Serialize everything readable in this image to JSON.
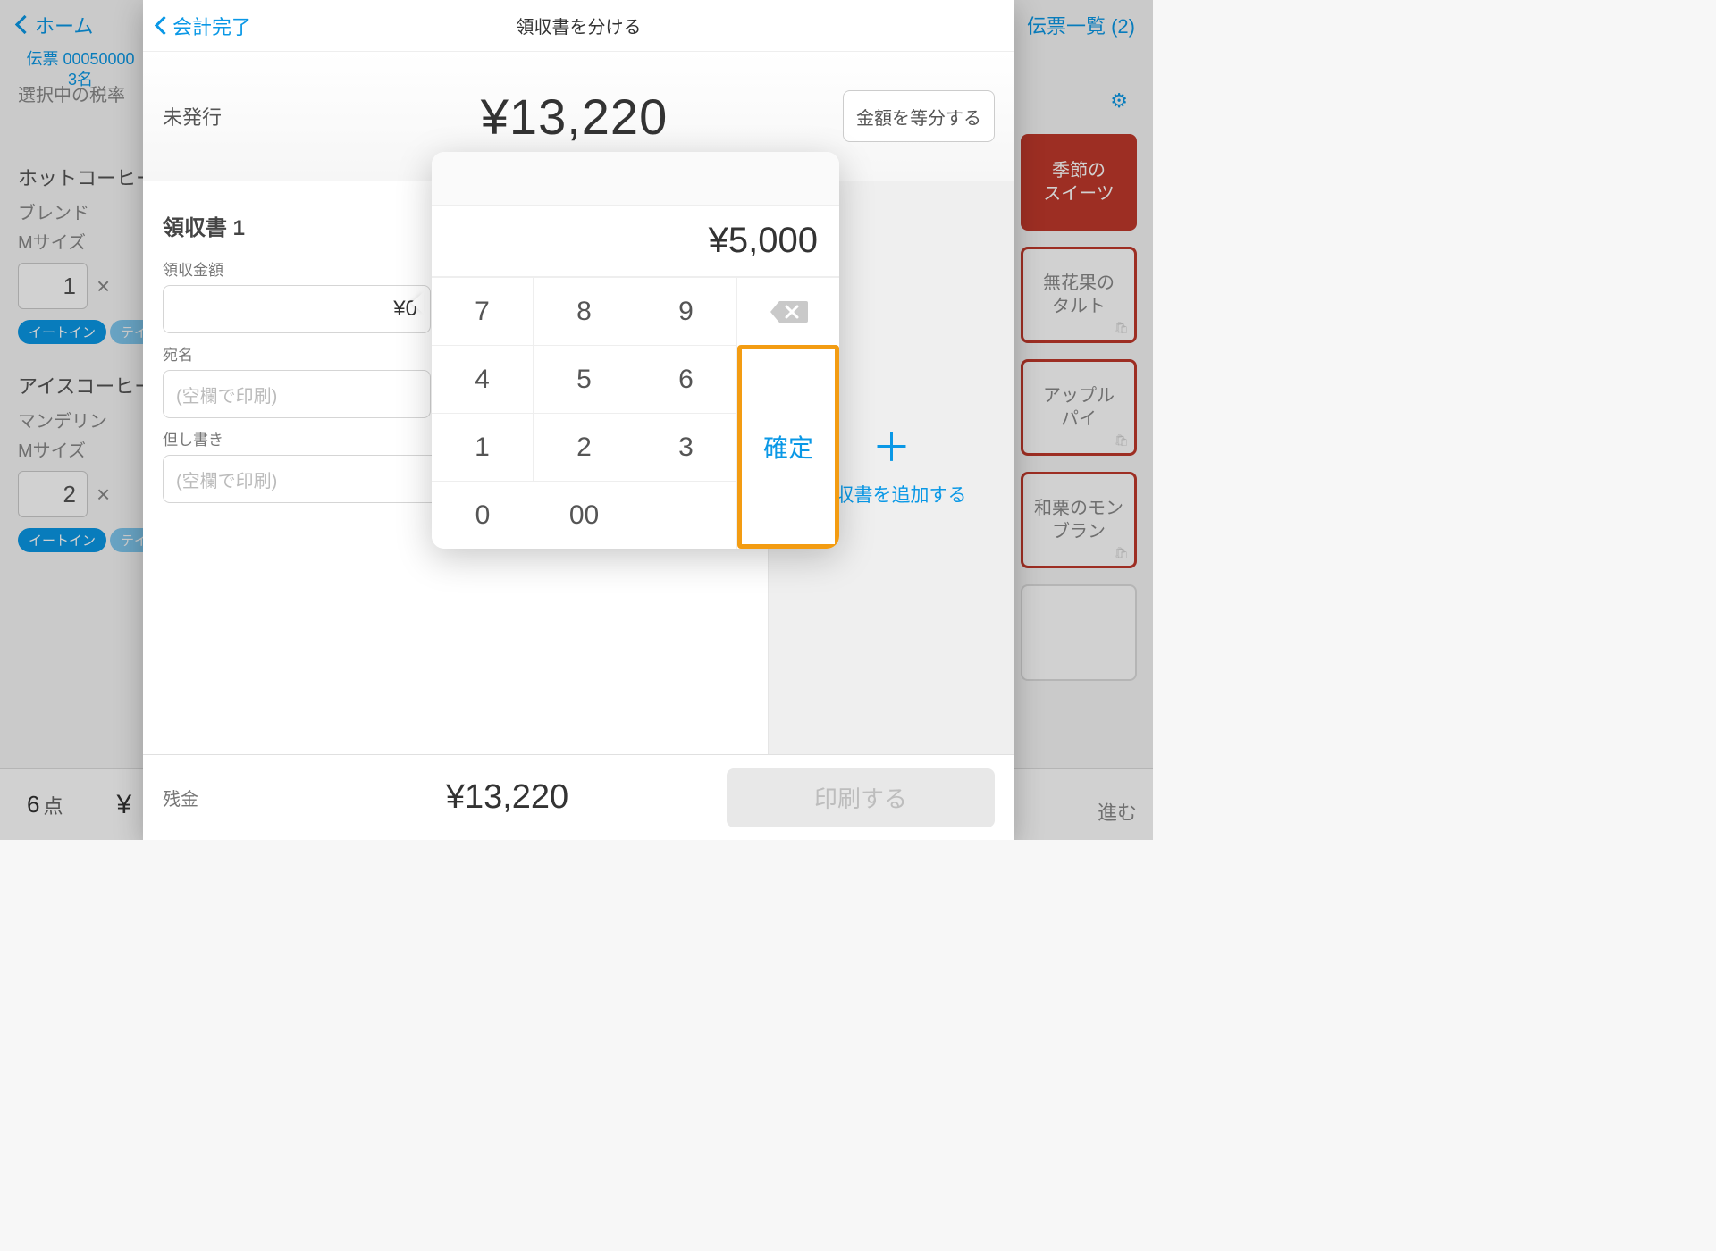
{
  "bg": {
    "home": "ホーム",
    "slipList": "伝票一覧 (2)",
    "slipNo": "伝票 00050000",
    "guests": "3名",
    "taxLabel": "選択中の税率",
    "cat1": "ホットコーヒー",
    "item1_name": "ブレンド",
    "item1_size": "Mサイズ",
    "item1_qty": "1",
    "cat2": "アイスコーヒー",
    "item2_name": "マンデリン",
    "item2_size": "Mサイズ",
    "item2_qty": "2",
    "eatin": "イートイン",
    "takeout": "テイ",
    "points": "6",
    "pointsUnit": "点",
    "yen": "¥",
    "proceed": "進む",
    "card1": "季節の\nスイーツ",
    "card2": "無花果の\nタルト",
    "card3": "アップル\nパイ",
    "card4": "和栗のモン\nブラン"
  },
  "modal": {
    "back": "会計完了",
    "title": "領収書を分ける",
    "unissued": "未発行",
    "total": "¥13,220",
    "equalSplit": "金額を等分する",
    "receiptTitle": "領収書 1",
    "amountLabel": "領収金額",
    "amountValue": "¥0",
    "nameLabel": "宛名",
    "namePlaceholder": "(空欄で印刷)",
    "noteLabel": "但し書き",
    "notePlaceholder": "(空欄で印刷)",
    "addReceipt": "領収書を追加する",
    "remainLabel": "残金",
    "remainValue": "¥13,220",
    "print": "印刷する"
  },
  "keypad": {
    "display": "¥5,000",
    "k7": "7",
    "k8": "8",
    "k9": "9",
    "k4": "4",
    "k5": "5",
    "k6": "6",
    "k1": "1",
    "k2": "2",
    "k3": "3",
    "k0": "0",
    "k00": "00",
    "confirm": "確定"
  }
}
